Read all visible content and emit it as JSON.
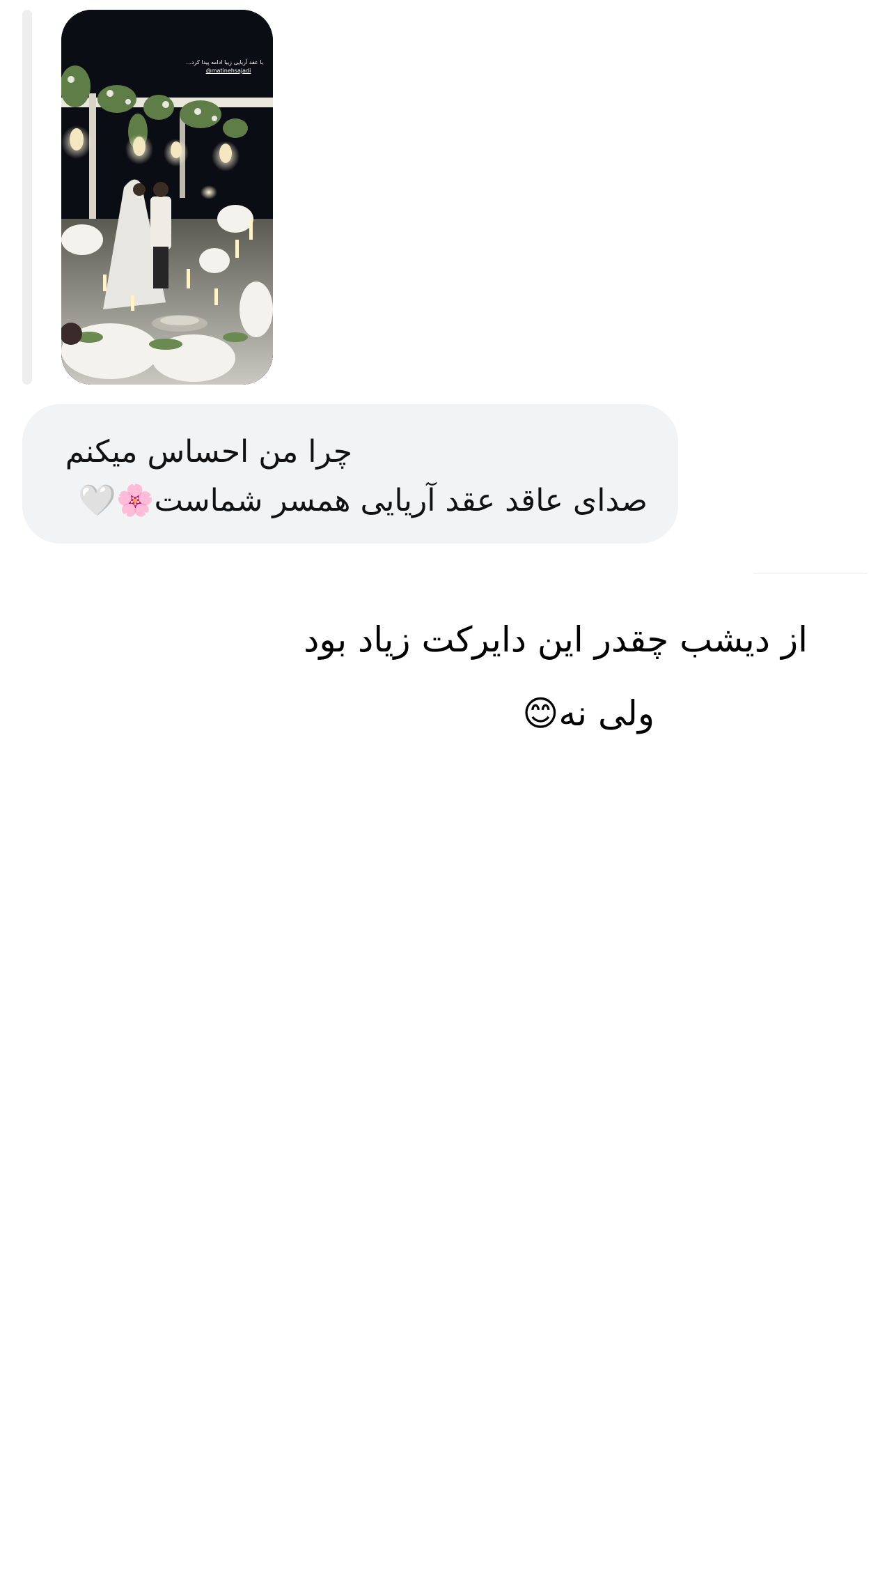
{
  "shared_story": {
    "caption": "با عقد آریایی زیبا ادامه پیدا کرد...",
    "handle": "@matinehsajadi"
  },
  "incoming_message": {
    "line1": "چرا من احساس میکنم",
    "line2": "صدای عاقد عقد آریایی همسر شماست🌸🤍"
  },
  "outgoing_message": {
    "line1": "از دیشب چقدر این دایرکت زیاد بود",
    "line2": "ولی نه😊"
  },
  "colors": {
    "incoming_bubble": "#f2f3f5",
    "background": "#ffffff",
    "text": "#111111"
  }
}
